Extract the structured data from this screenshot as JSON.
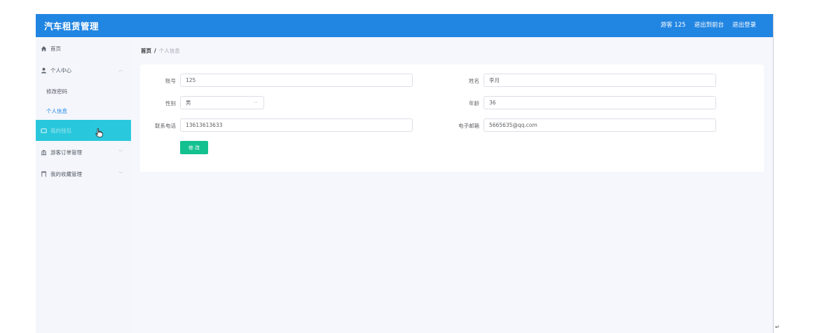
{
  "header": {
    "title": "汽车租赁管理",
    "user": "游客 125",
    "back_to_front": "退出到前台",
    "logout": "退出登录"
  },
  "sidebar": {
    "items": [
      {
        "label": "首页",
        "icon": "home-icon"
      },
      {
        "label": "个人中心",
        "icon": "user-icon"
      },
      {
        "label": "修改密码"
      },
      {
        "label": "个人信息"
      },
      {
        "label": "我的钱包",
        "icon": "wallet-icon"
      },
      {
        "label": "游客订单管理",
        "icon": "bank-icon"
      },
      {
        "label": "我的收藏管理",
        "icon": "collection-icon"
      }
    ]
  },
  "breadcrumb": {
    "home": "首页",
    "separator": "/",
    "current": "个人信息"
  },
  "form": {
    "account_label": "账号",
    "account_value": "125",
    "name_label": "姓名",
    "name_value": "李月",
    "gender_label": "性别",
    "gender_value": "男",
    "age_label": "年龄",
    "age_value": "36",
    "phone_label": "联系电话",
    "phone_value": "13613613633",
    "email_label": "电子邮箱",
    "email_value": "5665635@qq.com",
    "submit_label": "修 改"
  },
  "colors": {
    "header_bg": "#2185e2",
    "active_menu_bg": "#22c6dc",
    "submit_bg": "#13c08f"
  }
}
